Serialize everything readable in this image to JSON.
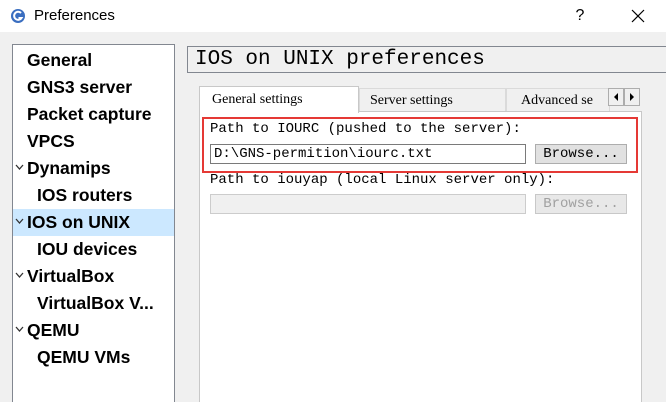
{
  "window": {
    "title": "Preferences",
    "help_label": "?",
    "icon": "gns3-logo-icon",
    "close_icon": "close-icon"
  },
  "sidebar": {
    "items": [
      {
        "label": "General",
        "level": 0,
        "expandable": false,
        "selected": false
      },
      {
        "label": "GNS3 server",
        "level": 0,
        "expandable": false,
        "selected": false
      },
      {
        "label": "Packet capture",
        "level": 0,
        "expandable": false,
        "selected": false
      },
      {
        "label": "VPCS",
        "level": 0,
        "expandable": false,
        "selected": false
      },
      {
        "label": "Dynamips",
        "level": 0,
        "expandable": true,
        "selected": false
      },
      {
        "label": "IOS routers",
        "level": 1,
        "expandable": false,
        "selected": false
      },
      {
        "label": "IOS on UNIX",
        "level": 0,
        "expandable": true,
        "selected": true
      },
      {
        "label": "IOU devices",
        "level": 1,
        "expandable": false,
        "selected": false
      },
      {
        "label": "VirtualBox",
        "level": 0,
        "expandable": true,
        "selected": false
      },
      {
        "label": "VirtualBox V...",
        "level": 1,
        "expandable": false,
        "selected": false
      },
      {
        "label": "QEMU",
        "level": 0,
        "expandable": true,
        "selected": false
      },
      {
        "label": "QEMU VMs",
        "level": 1,
        "expandable": false,
        "selected": false
      }
    ],
    "chevron_icon": "chevron-down-icon",
    "selection_color": "#cce8ff"
  },
  "main": {
    "header": "IOS on UNIX preferences",
    "tabs": [
      {
        "label": "General settings",
        "active": true
      },
      {
        "label": "Server settings",
        "active": false
      },
      {
        "label": "Advanced se",
        "active": false
      }
    ],
    "tab_scroll": {
      "left_icon": "arrow-left-icon",
      "right_icon": "arrow-right-icon"
    },
    "iourc": {
      "label": "Path to IOURC (pushed to the server):",
      "value": "D:\\GNS-permition\\iourc.txt",
      "browse_label": "Browse..."
    },
    "iouyap": {
      "label": "Path to iouyap (local Linux server only):",
      "value": "",
      "browse_label": "Browse...",
      "enabled": false
    },
    "highlight_color": "#e53935"
  }
}
